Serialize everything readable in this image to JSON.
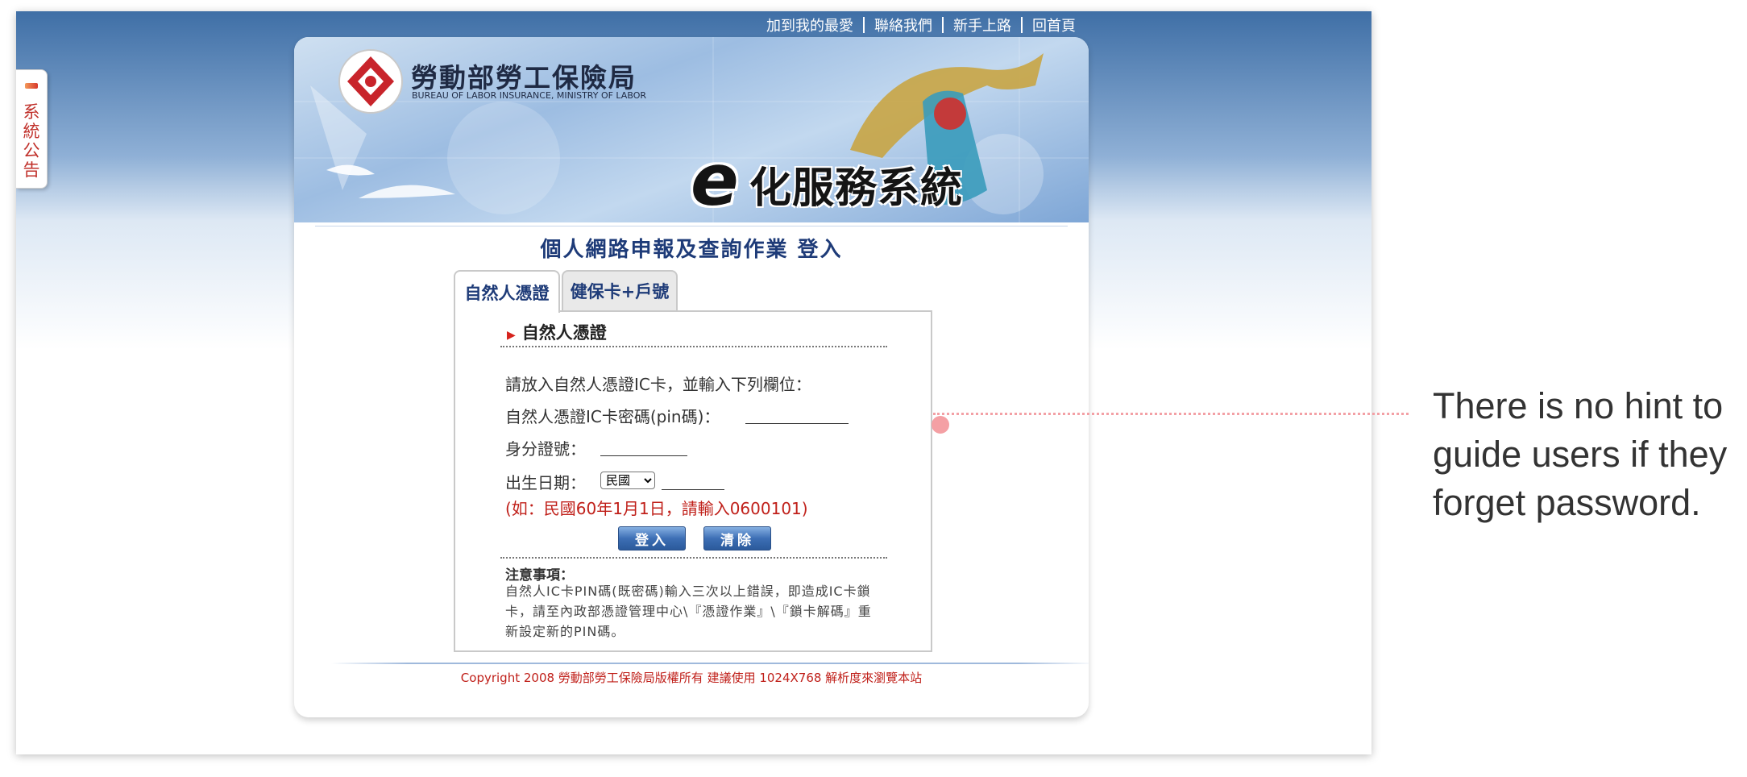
{
  "top_nav": {
    "links": [
      "加到我的最愛",
      "聯絡我們",
      "新手上路",
      "回首頁"
    ]
  },
  "side_tab": {
    "label": "系統公告"
  },
  "banner": {
    "org_name_cn": "勞動部勞工保險局",
    "org_name_en": "BUREAU OF LABOR INSURANCE, MINISTRY OF LABOR",
    "system_title_prefix": "e",
    "system_title": "化服務系統"
  },
  "main": {
    "heading": "個人網路申報及查詢作業 登入",
    "tabs": [
      {
        "label": "自然人憑證",
        "active": true
      },
      {
        "label": "健保卡+戶號",
        "active": false
      }
    ],
    "section_title": "自然人憑證",
    "instruction": "請放入自然人憑證IC卡，並輸入下列欄位：",
    "fields": {
      "pin_label": "自然人憑證IC卡密碼(pin碼)：",
      "id_label": "身分證號：",
      "birth_label": "出生日期：",
      "era_selected": "民國",
      "example": "(如：民國60年1月1日，請輸入0600101)"
    },
    "buttons": {
      "login": "登入",
      "clear": "清除"
    },
    "notes": {
      "title": "注意事項：",
      "body": "自然人IC卡PIN碼(既密碼)輸入三次以上錯誤，即造成IC卡鎖卡，請至內政部憑證管理中心\\『憑證作業』\\『鎖卡解碼』重新設定新的PIN碼。"
    }
  },
  "footer": {
    "copyright": "Copyright 2008 勞動部勞工保險局版權所有 建議使用 1024X768 解析度來瀏覽本站"
  },
  "annotation": {
    "text": "There is no hint to guide users if they forget password."
  },
  "colors": {
    "accent_blue": "#1e3b78",
    "warning_red": "#c0201a",
    "callout_pink": "#f4a0a4"
  }
}
